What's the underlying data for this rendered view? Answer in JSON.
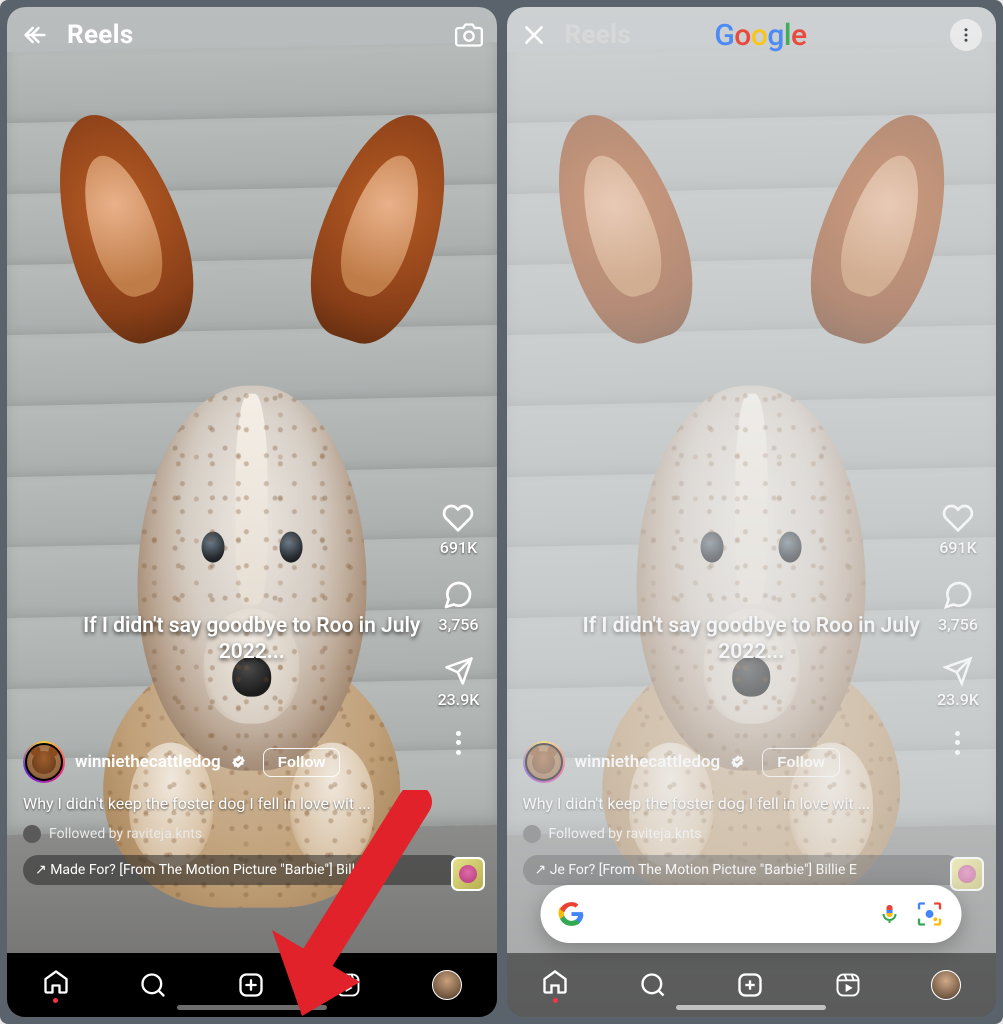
{
  "left": {
    "header": {
      "title": "Reels"
    },
    "caption": "If I didn't say goodbye to Roo in July 2022...",
    "rail": {
      "likes": "691K",
      "comments": "3,756",
      "shares": "23.9K"
    },
    "user": {
      "username": "winniethecattledog",
      "follow": "Follow"
    },
    "description": "Why I didn't keep the foster dog I fell in love wit ...",
    "followed_by": "Followed by raviteja.knts",
    "audio": "↗  Made For? [From The Motion Picture \"Barbie\"]    Billi"
  },
  "right": {
    "header": {
      "title": "Reels",
      "overlay_title": "Google"
    },
    "caption": "If I didn't say goodbye to Roo in July 2022...",
    "rail": {
      "likes": "691K",
      "comments": "3,756",
      "shares": "23.9K"
    },
    "user": {
      "username": "winniethecattledog",
      "follow": "Follow"
    },
    "description": "Why I didn't keep the foster dog I fell in love wit ...",
    "followed_by": "Followed by raviteja.knts",
    "audio": "↗  Je For? [From The Motion Picture \"Barbie\"]    Billie E"
  }
}
